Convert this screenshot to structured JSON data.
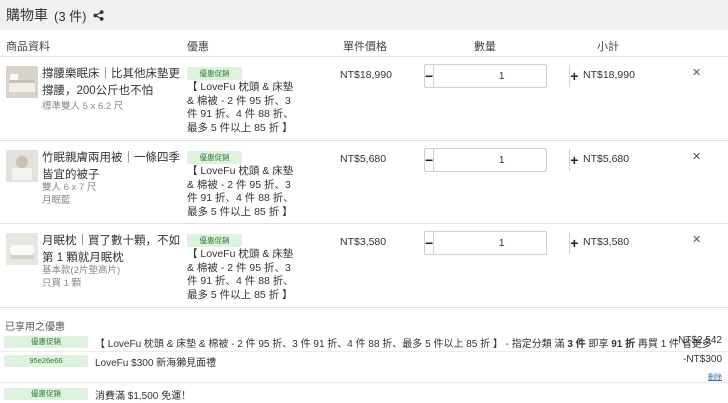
{
  "header": {
    "title": "購物車",
    "count": "(3 件)",
    "share_icon": "share-icon"
  },
  "columns": {
    "product": "商品資料",
    "promo": "優惠",
    "unit_price": "單件價格",
    "quantity": "數量",
    "subtotal": "小計"
  },
  "items": [
    {
      "thumb_color": "#d9d4cb",
      "name": "撐腰樂眠床｜比其他床墊更撐腰，200公斤也不怕",
      "meta1": "標準雙人 5 x 6.2 尺",
      "meta2": "",
      "promo_badge": "優惠促銷",
      "promo_text": "【 LoveFu 枕頭 & 床墊 & 棉被 - 2 件 95 折、3 件 91 折、4 件 88 折、最多 5 件以上 85 折 】",
      "price": "NT$18,990",
      "qty": "1",
      "subtotal": "NT$18,990",
      "remove_icon": "close-icon"
    },
    {
      "thumb_color": "#e4e1dc",
      "name": "竹眠親膚兩用被｜一條四季皆宜的被子",
      "meta1": "雙人 6 x 7 尺",
      "meta2": "月眠藍",
      "promo_badge": "優惠促銷",
      "promo_text": "【 LoveFu 枕頭 & 床墊 & 棉被 - 2 件 95 折、3 件 91 折、4 件 88 折、最多 5 件以上 85 折 】",
      "price": "NT$5,680",
      "qty": "1",
      "subtotal": "NT$5,680",
      "remove_icon": "close-icon"
    },
    {
      "thumb_color": "#e8e6e1",
      "name": "月眠枕｜買了數十顆，不如第 1 顆就月眠枕",
      "meta1": "基本款(2片墊高片)",
      "meta2": "只買 1 顆",
      "promo_badge": "優惠促銷",
      "promo_text": "【 LoveFu 枕頭 & 床墊 & 棉被 - 2 件 95 折、3 件 91 折、4 件 88 折、最多 5 件以上 85 折 】",
      "price": "NT$3,580",
      "qty": "1",
      "subtotal": "NT$3,580",
      "remove_icon": "close-icon"
    }
  ],
  "applied": {
    "title": "已享用之優惠",
    "discounts": [
      {
        "badge": "優惠促銷",
        "text_a": "【 LoveFu 枕頭 & 床墊 & 棉被 - 2 件 95 折、3 件 91 折、4 件 88 折、最多 5 件以上 85 折 】 - 指定分類 滿 ",
        "text_b": "3 件",
        "text_c": " 即享 ",
        "text_d": "91 折",
        "text_e": " 再買 1 件 省更多",
        "amount": "-NT$2,542"
      },
      {
        "badge": "95e26e66",
        "text_a": "LoveFu $300 新海獺見面禮",
        "amount": "-NT$300"
      },
      {
        "badge": "優惠促銷",
        "text_a": "消費滿 $1,500 免運！",
        "amount": ""
      }
    ],
    "delete_label": "刪除"
  },
  "colors": {
    "badge_bg": "#dff2df",
    "badge_text": "#2e7d32",
    "header_bg": "#f0f0f0"
  }
}
